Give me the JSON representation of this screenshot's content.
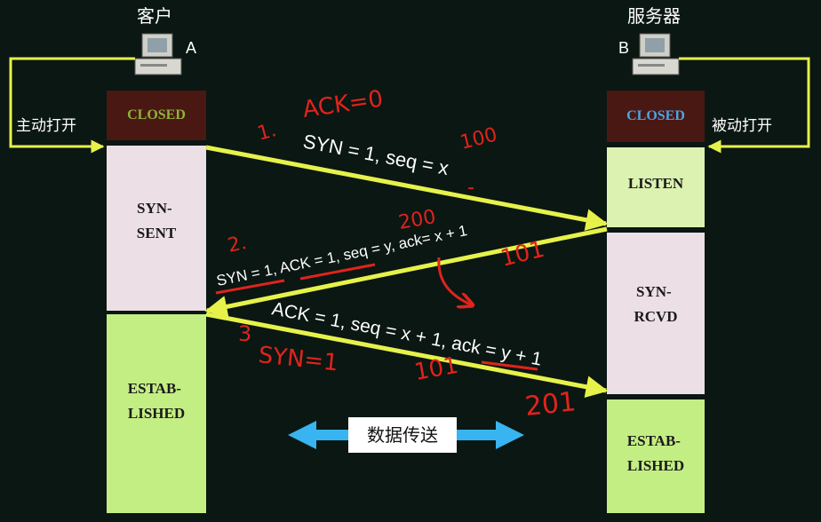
{
  "client": {
    "title": "客户",
    "letter": "A",
    "open_label": "主动打开",
    "states": [
      "CLOSED",
      "SYN-\nSENT",
      "ESTAB-\nLISHED"
    ]
  },
  "server": {
    "title": "服务器",
    "letter": "B",
    "open_label": "被动打开",
    "states": [
      "CLOSED",
      "LISTEN",
      "SYN-\nRCVD",
      "ESTAB-\nLISHED"
    ]
  },
  "messages": [
    {
      "text": "SYN = 1, seq = x"
    },
    {
      "text": "SYN = 1, ACK = 1, seq = y, ack= x + 1"
    },
    {
      "text": "ACK = 1, seq = x + 1, ack = y + 1"
    }
  ],
  "data_transfer_label": "数据传送",
  "annotations": {
    "step1": "1.",
    "ack0": "ACK=0",
    "n100": "100",
    "n200": "200",
    "step2": "2.",
    "n101a": "101",
    "step3": "3",
    "syn1": "SYN=1",
    "n101b": "101",
    "n201": "201"
  },
  "colors": {
    "background": "#0b1712",
    "closed_box": "#4a1812",
    "closed_text_client": "#8db33a",
    "closed_text_server": "#4aa3e6",
    "syn_sent_box": "#ecdfe5",
    "established_box": "#c3ee84",
    "listen_box": "#dcf2b0",
    "arrow": "#e6f24a",
    "annotation": "#e0231d",
    "transfer_arrow": "#38b4f0"
  }
}
